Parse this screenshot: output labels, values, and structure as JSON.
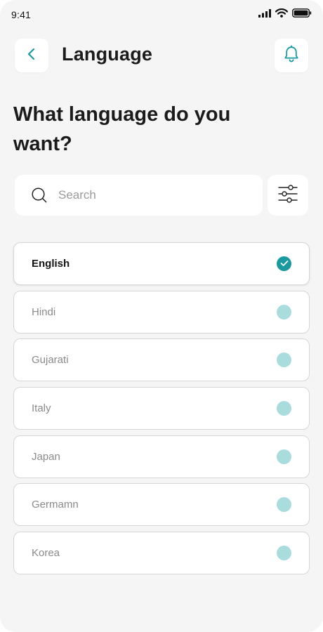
{
  "status_bar": {
    "time": "9:41"
  },
  "header": {
    "title": "Language"
  },
  "question": "What language do you want?",
  "search": {
    "placeholder": "Search",
    "value": ""
  },
  "colors": {
    "accent": "#1a9aa0",
    "radio_unselected": "#a9dcdd",
    "background": "#f5f5f5"
  },
  "languages": [
    {
      "label": "English",
      "selected": true
    },
    {
      "label": "Hindi",
      "selected": false
    },
    {
      "label": "Gujarati",
      "selected": false
    },
    {
      "label": "Italy",
      "selected": false
    },
    {
      "label": "Japan",
      "selected": false
    },
    {
      "label": "Germamn",
      "selected": false
    },
    {
      "label": "Korea",
      "selected": false
    }
  ],
  "icons": [
    "back-icon",
    "bell-icon",
    "search-icon",
    "filter-icon",
    "check-icon",
    "signal-icon",
    "wifi-icon",
    "battery-icon"
  ]
}
